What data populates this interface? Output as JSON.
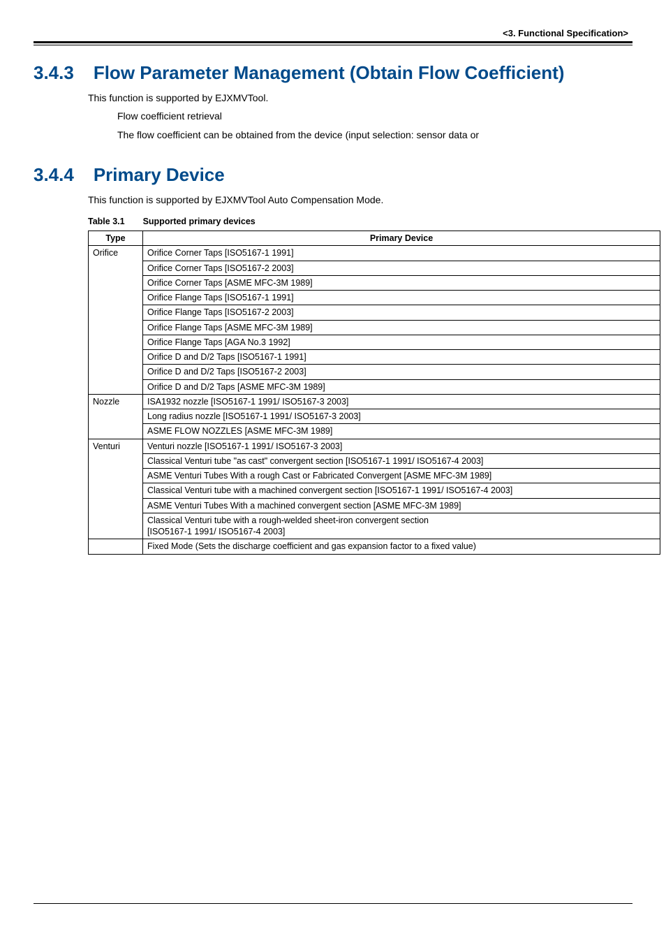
{
  "header": {
    "chapter_label": "<3.  Functional Specification>"
  },
  "section1": {
    "number": "3.4.3",
    "title": "Flow Parameter Management (Obtain Flow Coefficient)",
    "line1": "This function is supported by EJXMVTool.",
    "line2": "Flow coefficient retrieval",
    "line3": "The flow coefficient can be obtained from the device (input selection: sensor data or"
  },
  "section2": {
    "number": "3.4.4",
    "title": "Primary Device",
    "line1": "This function is supported by EJXMVTool Auto Compensation Mode."
  },
  "table": {
    "caption_num": "Table 3.1",
    "caption_text": "Supported primary devices",
    "headers": {
      "type": "Type",
      "device": "Primary Device"
    },
    "groups": [
      {
        "type": "Orifice",
        "rows": [
          "Orifice Corner Taps [ISO5167-1 1991]",
          "Orifice Corner Taps [ISO5167-2 2003]",
          "Orifice Corner Taps [ASME MFC-3M 1989]",
          "Orifice Flange Taps [ISO5167-1 1991]",
          "Orifice Flange Taps [ISO5167-2 2003]",
          "Orifice Flange Taps [ASME MFC-3M 1989]",
          "Orifice Flange Taps [AGA No.3 1992]",
          "Orifice D and D/2 Taps [ISO5167-1 1991]",
          "Orifice D and D/2 Taps [ISO5167-2 2003]",
          "Orifice D and D/2 Taps [ASME MFC-3M 1989]"
        ]
      },
      {
        "type": "Nozzle",
        "rows": [
          "ISA1932 nozzle [ISO5167-1 1991/ ISO5167-3 2003]",
          "Long radius nozzle [ISO5167-1 1991/ ISO5167-3 2003]",
          "ASME FLOW NOZZLES [ASME MFC-3M 1989]"
        ]
      },
      {
        "type": "Venturi",
        "rows": [
          "Venturi nozzle [ISO5167-1 1991/ ISO5167-3 2003]",
          "Classical Venturi tube \"as cast\" convergent section [ISO5167-1 1991/ ISO5167-4 2003]",
          "ASME Venturi Tubes With a rough Cast or Fabricated Convergent [ASME MFC-3M 1989]",
          "Classical Venturi tube with a machined convergent section [ISO5167-1 1991/ ISO5167-4 2003]",
          "ASME Venturi Tubes With a machined convergent section [ASME MFC-3M 1989]",
          "Classical Venturi tube with a rough-welded sheet-iron convergent section\n[ISO5167-1 1991/ ISO5167-4 2003]"
        ]
      },
      {
        "type": "",
        "rows": [
          "Fixed Mode (Sets the discharge coefficient and gas expansion factor to a fixed value)"
        ]
      }
    ]
  }
}
